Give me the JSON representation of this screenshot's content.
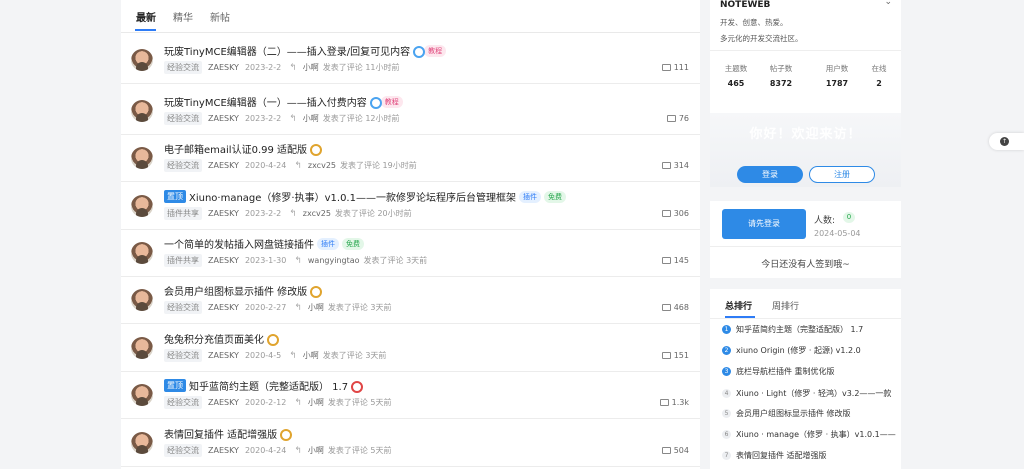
{
  "tabs": [
    {
      "label": "最新",
      "active": true
    },
    {
      "label": "精华",
      "active": false
    },
    {
      "label": "新帖",
      "active": false
    }
  ],
  "threads": [
    {
      "pin": "",
      "title": "玩废TinyMCE编辑器（二）——插入登录/回复可见内容",
      "medal": "blue",
      "tags": [
        {
          "text": "教程",
          "color": "pink"
        }
      ],
      "forum": "经验交流",
      "author": "ZAESKY",
      "date": "2023-2-2",
      "replier": "小啊",
      "reply_text": "发表了评论 11小时前",
      "count": "111"
    },
    {
      "pin": "",
      "title": "玩废TinyMCE编辑器（一）——插入付费内容",
      "medal": "blue",
      "tags": [
        {
          "text": "教程",
          "color": "pink"
        }
      ],
      "forum": "经验交流",
      "author": "ZAESKY",
      "date": "2023-2-2",
      "replier": "小啊",
      "reply_text": "发表了评论 12小时前",
      "count": "76"
    },
    {
      "pin": "",
      "title": "电子邮箱email认证0.99 适配版",
      "medal": "gold",
      "tags": [],
      "forum": "经验交流",
      "author": "ZAESKY",
      "date": "2020-4-24",
      "replier": "zxcv25",
      "reply_text": "发表了评论 19小时前",
      "count": "314"
    },
    {
      "pin": "置顶",
      "title": "Xiuno·manage（修罗·执事）v1.0.1——一款修罗论坛程序后台管理框架",
      "medal": "",
      "tags": [
        {
          "text": "插件",
          "color": "blue"
        },
        {
          "text": "免费",
          "color": "green"
        }
      ],
      "forum": "插件共享",
      "author": "ZAESKY",
      "date": "2023-2-2",
      "replier": "zxcv25",
      "reply_text": "发表了评论 20小时前",
      "count": "306"
    },
    {
      "pin": "",
      "title": "一个简单的发帖插入网盘链接插件",
      "medal": "",
      "tags": [
        {
          "text": "插件",
          "color": "blue"
        },
        {
          "text": "免费",
          "color": "green"
        }
      ],
      "forum": "插件共享",
      "author": "ZAESKY",
      "date": "2023-1-30",
      "replier": "wangyingtao",
      "reply_text": "发表了评论 3天前",
      "count": "145"
    },
    {
      "pin": "",
      "title": "会员用户组图标显示插件 修改版",
      "medal": "gold",
      "tags": [],
      "forum": "经验交流",
      "author": "ZAESKY",
      "date": "2020-2-27",
      "replier": "小啊",
      "reply_text": "发表了评论 3天前",
      "count": "468"
    },
    {
      "pin": "",
      "title": "兔兔积分充值页面美化",
      "medal": "gold",
      "tags": [],
      "forum": "经验交流",
      "author": "ZAESKY",
      "date": "2020-4-5",
      "replier": "小啊",
      "reply_text": "发表了评论 3天前",
      "count": "151"
    },
    {
      "pin": "置顶",
      "title": "知乎蓝简约主题（完整适配版） 1.7",
      "medal": "red",
      "tags": [],
      "forum": "经验交流",
      "author": "ZAESKY",
      "date": "2020-2-12",
      "replier": "小啊",
      "reply_text": "发表了评论 5天前",
      "count": "1.3k"
    },
    {
      "pin": "",
      "title": "表情回复插件 适配增强版",
      "medal": "gold",
      "tags": [],
      "forum": "经验交流",
      "author": "ZAESKY",
      "date": "2020-4-24",
      "replier": "小啊",
      "reply_text": "发表了评论 5天前",
      "count": "504"
    }
  ],
  "site": {
    "name": "NOTEWEB",
    "desc1": "开发、创意、热爱。",
    "desc2": "多元化的开发交流社区。"
  },
  "stats": [
    {
      "label": "主题数",
      "value": "465"
    },
    {
      "label": "帖子数",
      "value": "8372"
    },
    {
      "label": "用户数",
      "value": "1787"
    },
    {
      "label": "在线",
      "value": "2"
    }
  ],
  "welcome": {
    "text": "你好！欢迎来访！",
    "login_label": "登录",
    "register_label": "注册"
  },
  "signin": {
    "button_label": "请先登录",
    "people_label": "人数:",
    "people_value": "0",
    "date": "2024-05-04",
    "empty_text": "今日还没有人签到哦~"
  },
  "ranking": {
    "tabs": [
      "总排行",
      "周排行"
    ],
    "items": [
      {
        "num": "1",
        "title": "知乎蓝简约主题（完整适配版） 1.7"
      },
      {
        "num": "2",
        "title": "xiuno Origin (修罗 · 起源) v1.2.0"
      },
      {
        "num": "3",
        "title": "底栏导航栏插件 重制优化版"
      },
      {
        "num": "4",
        "title": "Xiuno · Light（修罗 · 轻鸿）v3.2——一款"
      },
      {
        "num": "5",
        "title": "会员用户组图标显示插件 修改版"
      },
      {
        "num": "6",
        "title": "Xiuno · manage（修罗 · 执事）v1.0.1——"
      },
      {
        "num": "7",
        "title": "表情回复插件 适配增强版"
      }
    ]
  },
  "colors": {
    "accent": "#2e8ae6",
    "link_blue": "#2e7cf6"
  },
  "icons": {
    "reply": "reply-arrow-icon",
    "comment": "comment-icon",
    "back_to_top": "arrow-up-icon"
  }
}
